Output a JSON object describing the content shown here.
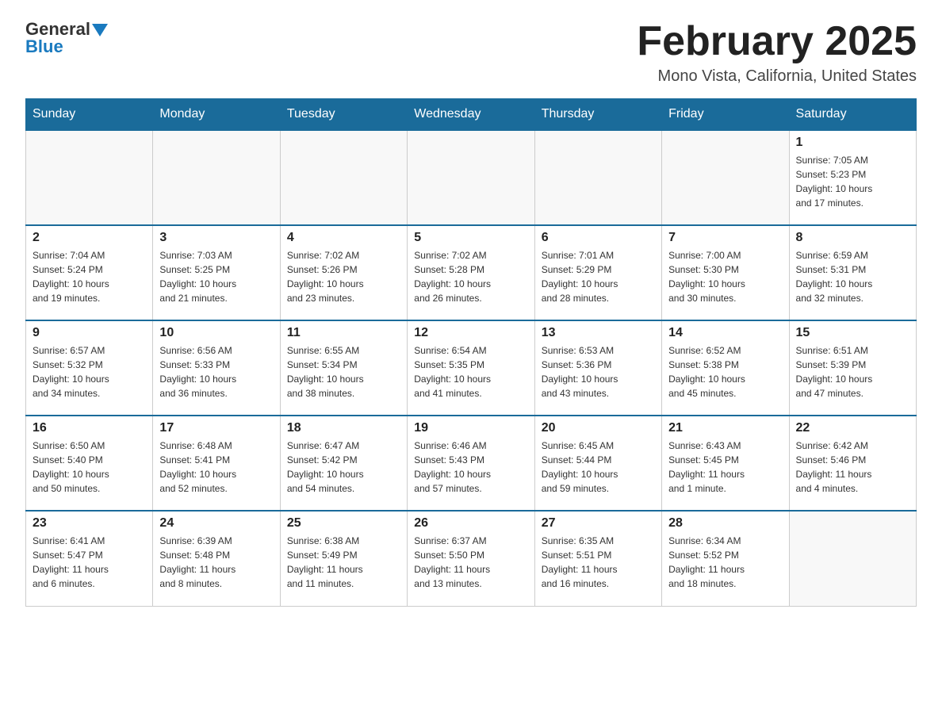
{
  "header": {
    "logo_general": "General",
    "logo_blue": "Blue",
    "month_title": "February 2025",
    "location": "Mono Vista, California, United States"
  },
  "days_of_week": [
    "Sunday",
    "Monday",
    "Tuesday",
    "Wednesday",
    "Thursday",
    "Friday",
    "Saturday"
  ],
  "weeks": [
    [
      {
        "day": "",
        "info": ""
      },
      {
        "day": "",
        "info": ""
      },
      {
        "day": "",
        "info": ""
      },
      {
        "day": "",
        "info": ""
      },
      {
        "day": "",
        "info": ""
      },
      {
        "day": "",
        "info": ""
      },
      {
        "day": "1",
        "info": "Sunrise: 7:05 AM\nSunset: 5:23 PM\nDaylight: 10 hours\nand 17 minutes."
      }
    ],
    [
      {
        "day": "2",
        "info": "Sunrise: 7:04 AM\nSunset: 5:24 PM\nDaylight: 10 hours\nand 19 minutes."
      },
      {
        "day": "3",
        "info": "Sunrise: 7:03 AM\nSunset: 5:25 PM\nDaylight: 10 hours\nand 21 minutes."
      },
      {
        "day": "4",
        "info": "Sunrise: 7:02 AM\nSunset: 5:26 PM\nDaylight: 10 hours\nand 23 minutes."
      },
      {
        "day": "5",
        "info": "Sunrise: 7:02 AM\nSunset: 5:28 PM\nDaylight: 10 hours\nand 26 minutes."
      },
      {
        "day": "6",
        "info": "Sunrise: 7:01 AM\nSunset: 5:29 PM\nDaylight: 10 hours\nand 28 minutes."
      },
      {
        "day": "7",
        "info": "Sunrise: 7:00 AM\nSunset: 5:30 PM\nDaylight: 10 hours\nand 30 minutes."
      },
      {
        "day": "8",
        "info": "Sunrise: 6:59 AM\nSunset: 5:31 PM\nDaylight: 10 hours\nand 32 minutes."
      }
    ],
    [
      {
        "day": "9",
        "info": "Sunrise: 6:57 AM\nSunset: 5:32 PM\nDaylight: 10 hours\nand 34 minutes."
      },
      {
        "day": "10",
        "info": "Sunrise: 6:56 AM\nSunset: 5:33 PM\nDaylight: 10 hours\nand 36 minutes."
      },
      {
        "day": "11",
        "info": "Sunrise: 6:55 AM\nSunset: 5:34 PM\nDaylight: 10 hours\nand 38 minutes."
      },
      {
        "day": "12",
        "info": "Sunrise: 6:54 AM\nSunset: 5:35 PM\nDaylight: 10 hours\nand 41 minutes."
      },
      {
        "day": "13",
        "info": "Sunrise: 6:53 AM\nSunset: 5:36 PM\nDaylight: 10 hours\nand 43 minutes."
      },
      {
        "day": "14",
        "info": "Sunrise: 6:52 AM\nSunset: 5:38 PM\nDaylight: 10 hours\nand 45 minutes."
      },
      {
        "day": "15",
        "info": "Sunrise: 6:51 AM\nSunset: 5:39 PM\nDaylight: 10 hours\nand 47 minutes."
      }
    ],
    [
      {
        "day": "16",
        "info": "Sunrise: 6:50 AM\nSunset: 5:40 PM\nDaylight: 10 hours\nand 50 minutes."
      },
      {
        "day": "17",
        "info": "Sunrise: 6:48 AM\nSunset: 5:41 PM\nDaylight: 10 hours\nand 52 minutes."
      },
      {
        "day": "18",
        "info": "Sunrise: 6:47 AM\nSunset: 5:42 PM\nDaylight: 10 hours\nand 54 minutes."
      },
      {
        "day": "19",
        "info": "Sunrise: 6:46 AM\nSunset: 5:43 PM\nDaylight: 10 hours\nand 57 minutes."
      },
      {
        "day": "20",
        "info": "Sunrise: 6:45 AM\nSunset: 5:44 PM\nDaylight: 10 hours\nand 59 minutes."
      },
      {
        "day": "21",
        "info": "Sunrise: 6:43 AM\nSunset: 5:45 PM\nDaylight: 11 hours\nand 1 minute."
      },
      {
        "day": "22",
        "info": "Sunrise: 6:42 AM\nSunset: 5:46 PM\nDaylight: 11 hours\nand 4 minutes."
      }
    ],
    [
      {
        "day": "23",
        "info": "Sunrise: 6:41 AM\nSunset: 5:47 PM\nDaylight: 11 hours\nand 6 minutes."
      },
      {
        "day": "24",
        "info": "Sunrise: 6:39 AM\nSunset: 5:48 PM\nDaylight: 11 hours\nand 8 minutes."
      },
      {
        "day": "25",
        "info": "Sunrise: 6:38 AM\nSunset: 5:49 PM\nDaylight: 11 hours\nand 11 minutes."
      },
      {
        "day": "26",
        "info": "Sunrise: 6:37 AM\nSunset: 5:50 PM\nDaylight: 11 hours\nand 13 minutes."
      },
      {
        "day": "27",
        "info": "Sunrise: 6:35 AM\nSunset: 5:51 PM\nDaylight: 11 hours\nand 16 minutes."
      },
      {
        "day": "28",
        "info": "Sunrise: 6:34 AM\nSunset: 5:52 PM\nDaylight: 11 hours\nand 18 minutes."
      },
      {
        "day": "",
        "info": ""
      }
    ]
  ]
}
